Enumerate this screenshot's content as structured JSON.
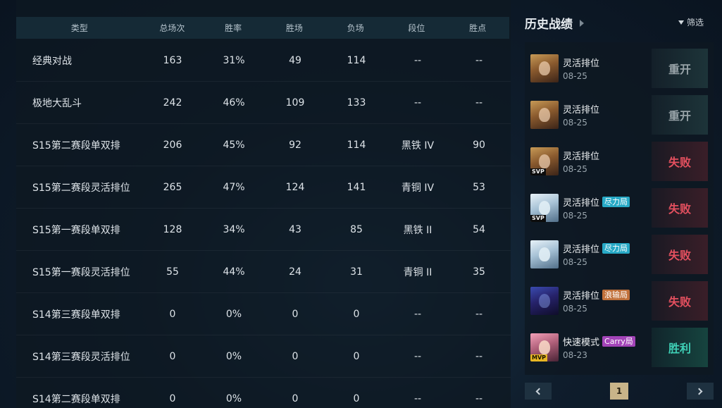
{
  "stats": {
    "headers": [
      "类型",
      "总场次",
      "胜率",
      "胜场",
      "负场",
      "段位",
      "胜点"
    ],
    "rows": [
      [
        "经典对战",
        "163",
        "31%",
        "49",
        "114",
        "--",
        "--"
      ],
      [
        "极地大乱斗",
        "242",
        "46%",
        "109",
        "133",
        "--",
        "--"
      ],
      [
        "S15第二赛段单双排",
        "206",
        "45%",
        "92",
        "114",
        "黑铁 IV",
        "90"
      ],
      [
        "S15第二赛段灵活排位",
        "265",
        "47%",
        "124",
        "141",
        "青铜 IV",
        "53"
      ],
      [
        "S15第一赛段单双排",
        "128",
        "34%",
        "43",
        "85",
        "黑铁 II",
        "54"
      ],
      [
        "S15第一赛段灵活排位",
        "55",
        "44%",
        "24",
        "31",
        "青铜 II",
        "35"
      ],
      [
        "S14第三赛段单双排",
        "0",
        "0%",
        "0",
        "0",
        "--",
        "--"
      ],
      [
        "S14第三赛段灵活排位",
        "0",
        "0%",
        "0",
        "0",
        "--",
        "--"
      ],
      [
        "S14第二赛段单双排",
        "0",
        "0%",
        "0",
        "0",
        "--",
        "--"
      ]
    ]
  },
  "history": {
    "title": "历史战绩",
    "filter_label": "筛选",
    "matches": [
      {
        "mode": "灵活排位",
        "date": "08-25",
        "result": "重开",
        "result_type": "neutral",
        "label": "",
        "badge": "",
        "avatar": "gold"
      },
      {
        "mode": "灵活排位",
        "date": "08-25",
        "result": "重开",
        "result_type": "neutral",
        "label": "",
        "badge": "",
        "avatar": "gold"
      },
      {
        "mode": "灵活排位",
        "date": "08-25",
        "result": "失败",
        "result_type": "lose",
        "label": "",
        "badge": "SVP",
        "avatar": "gold"
      },
      {
        "mode": "灵活排位",
        "date": "08-25",
        "result": "失败",
        "result_type": "lose",
        "label": "尽力局",
        "label_color": "#27a9c6",
        "badge": "SVP",
        "avatar": "ice"
      },
      {
        "mode": "灵活排位",
        "date": "08-25",
        "result": "失败",
        "result_type": "lose",
        "label": "尽力局",
        "label_color": "#27a9c6",
        "badge": "",
        "avatar": "ice"
      },
      {
        "mode": "灵活排位",
        "date": "08-25",
        "result": "失败",
        "result_type": "lose",
        "label": "浪输局",
        "label_color": "#c0703a",
        "badge": "",
        "avatar": "void"
      },
      {
        "mode": "快速模式",
        "date": "08-23",
        "result": "胜利",
        "result_type": "win",
        "label": "Carry局",
        "label_color": "#a344b8",
        "badge": "MVP",
        "avatar": "pink"
      }
    ]
  },
  "pagination": {
    "current": "1"
  }
}
